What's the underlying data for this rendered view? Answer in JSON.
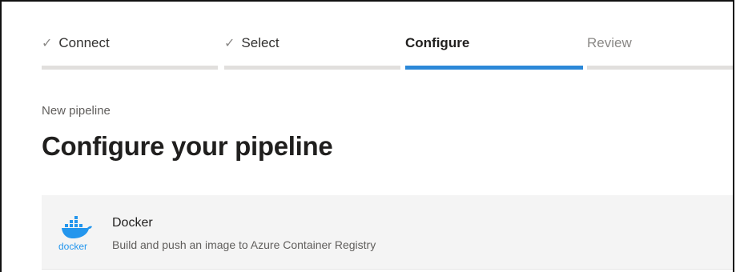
{
  "wizard": {
    "steps": [
      {
        "label": "Connect",
        "state": "done"
      },
      {
        "label": "Select",
        "state": "done"
      },
      {
        "label": "Configure",
        "state": "active"
      },
      {
        "label": "Review",
        "state": "todo"
      }
    ]
  },
  "page": {
    "breadcrumb": "New pipeline",
    "title": "Configure your pipeline"
  },
  "templates": [
    {
      "name": "Docker",
      "description": "Build and push an image to Azure Container Registry",
      "logo_text": "docker",
      "icon": "docker-icon"
    }
  ],
  "colors": {
    "accent": "#2b88d8",
    "docker_blue": "#2496ed",
    "track": "#e1dfdd",
    "card_bg": "#f4f4f4"
  }
}
